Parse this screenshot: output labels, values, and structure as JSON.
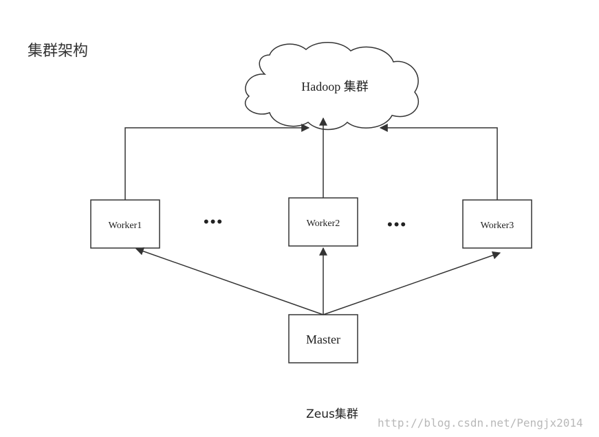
{
  "heading": "集群架构",
  "cloud": {
    "label": "Hadoop 集群"
  },
  "workers": [
    "Worker1",
    "Worker2",
    "Worker3"
  ],
  "master": {
    "label": "Master"
  },
  "ellipsis": "•••",
  "caption": "Zeus集群",
  "watermark": "http://blog.csdn.net/Pengjx2014"
}
